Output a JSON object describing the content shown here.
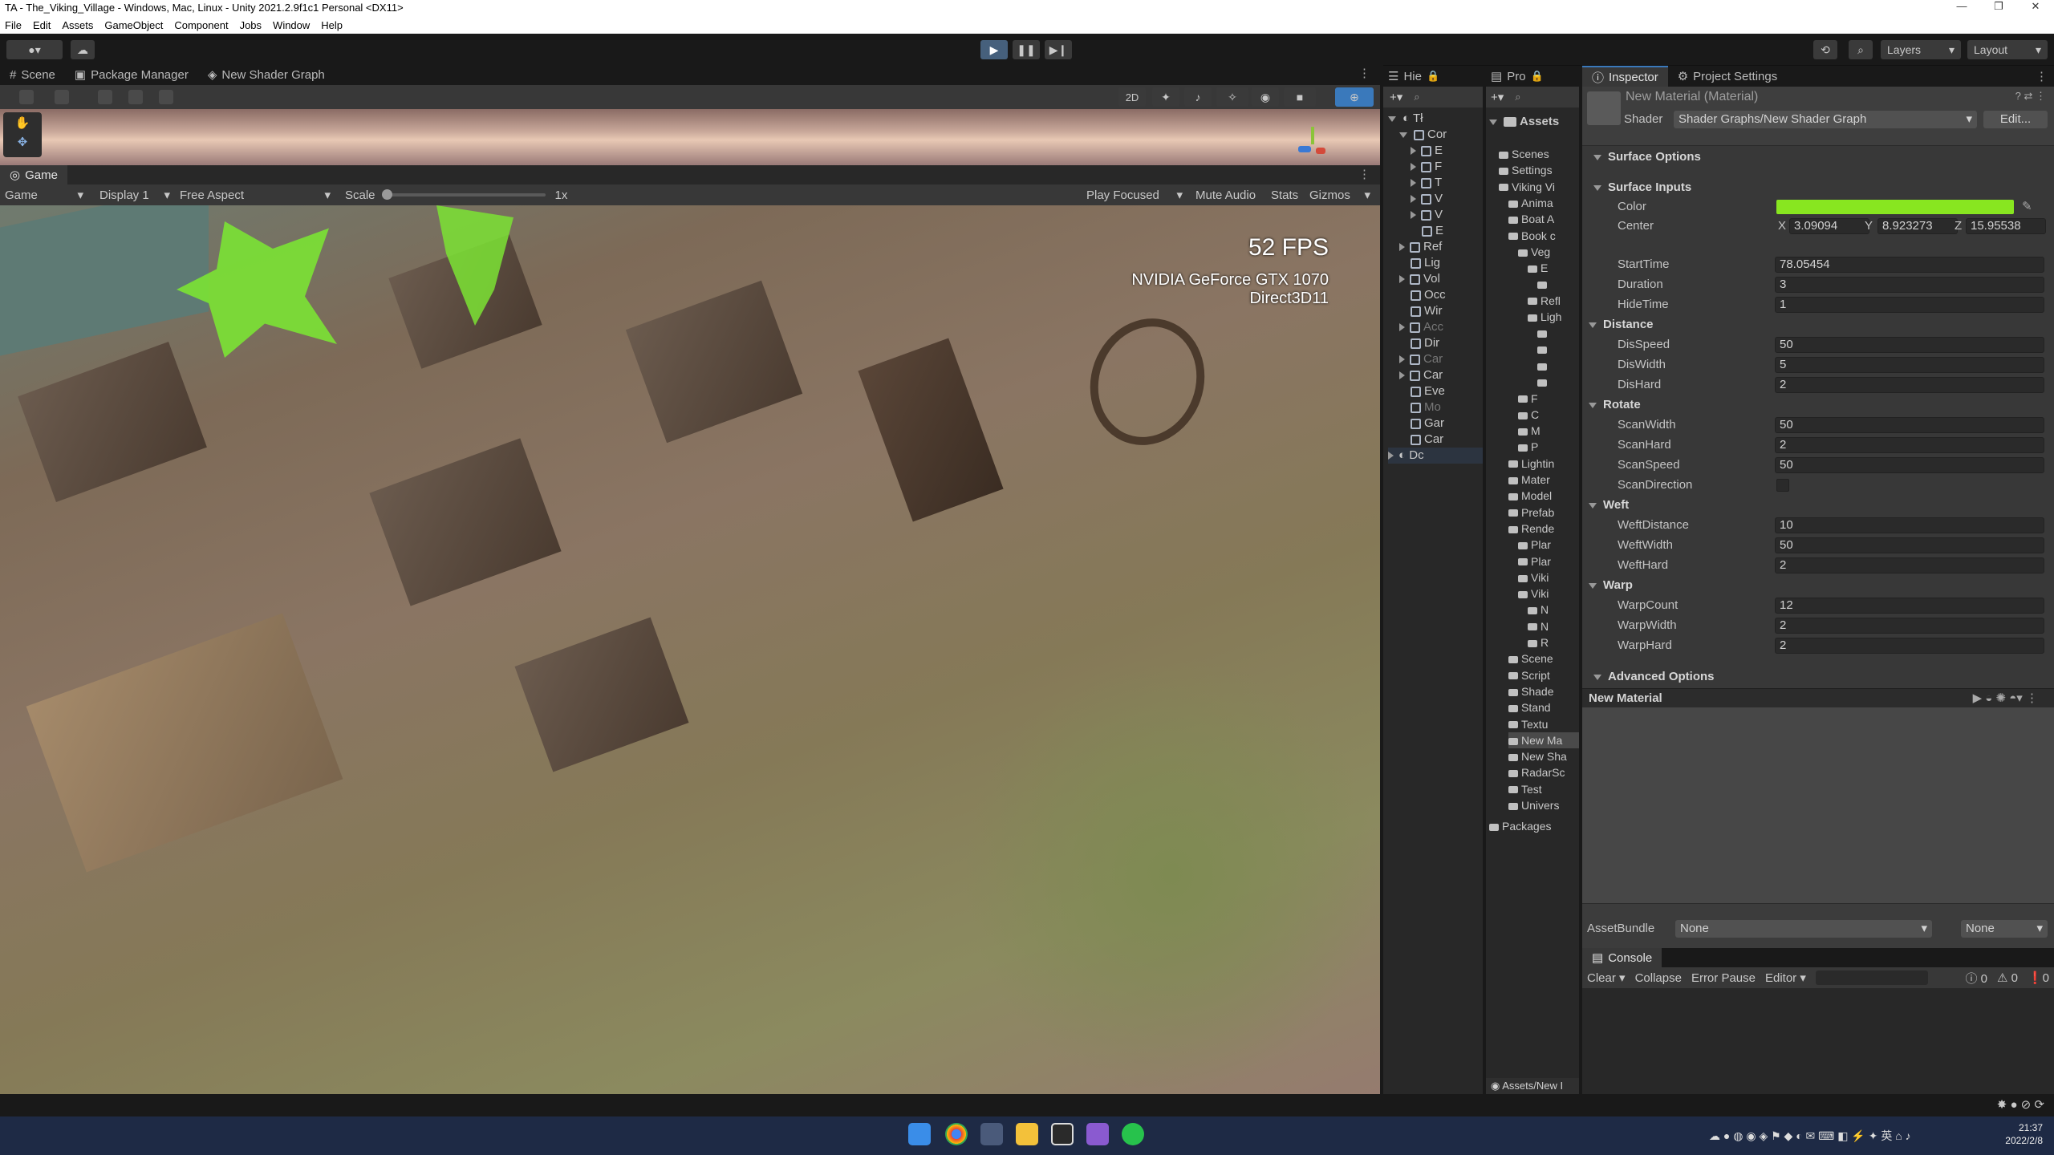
{
  "window": {
    "title": "TA - The_Viking_Village - Windows, Mac, Linux - Unity 2021.2.9f1c1 Personal <DX11>"
  },
  "menu": [
    "File",
    "Edit",
    "Assets",
    "GameObject",
    "Component",
    "Jobs",
    "Window",
    "Help"
  ],
  "toolbar": {
    "layers": "Layers",
    "layout": "Layout"
  },
  "tabs": {
    "scene": "Scene",
    "package_manager": "Package Manager",
    "shader_graph": "New Shader Graph",
    "game": "Game",
    "hierarchy": "Hie",
    "project": "Pro",
    "inspector": "Inspector",
    "project_settings": "Project Settings",
    "console": "Console"
  },
  "scene_toolbar": {
    "mode_2d": "2D"
  },
  "game_toolbar": {
    "view": "Game",
    "display": "Display 1",
    "aspect": "Free Aspect",
    "scale_label": "Scale",
    "scale_value": "1x",
    "play_focused": "Play Focused",
    "mute": "Mute Audio",
    "stats": "Stats",
    "gizmos": "Gizmos"
  },
  "overlay": {
    "fps": "52 FPS",
    "gpu": "NVIDIA GeForce GTX 1070",
    "api": "Direct3D11"
  },
  "hierarchy": {
    "scene": "Tł",
    "items": [
      "Cor",
      "E",
      "F",
      "T",
      "V",
      "V",
      "E",
      "Ref",
      "Lig",
      "Vol",
      "Occ",
      "Wir",
      "Acc",
      "Dir",
      "Car",
      "Car",
      "Eve",
      "Mo",
      "Gar",
      "Car",
      "Dc"
    ]
  },
  "project": {
    "root": "Assets",
    "items": [
      "Scenes",
      "Settings",
      "Viking Vi",
      "Anima",
      "Boat A",
      "Book c",
      "Veg",
      "E",
      "",
      "Refl",
      "Ligh",
      "",
      "",
      "",
      "",
      "F",
      "C",
      "M",
      "P",
      "Lightin",
      "Mater",
      "Model",
      "Prefab",
      "Rende",
      "Plar",
      "Plar",
      "Viki",
      "Viki",
      "N",
      "N",
      "R",
      "Scene",
      "Script",
      "Shade",
      "Stand",
      "Textu",
      "New Ma",
      "New Sha",
      "RadarSc",
      "Test",
      "Univers",
      "Packages"
    ],
    "path": "Assets/New I"
  },
  "inspector": {
    "title": "New Material (Material)",
    "shader_label": "Shader",
    "shader_value": "Shader Graphs/New Shader Graph",
    "edit_button": "Edit...",
    "surface_options": "Surface Options",
    "surface_inputs": "Surface Inputs",
    "color_label": "Color",
    "color_value": "#88e620",
    "center_label": "Center",
    "center": {
      "x_label": "X",
      "x": "3.09094",
      "y_label": "Y",
      "y": "8.923273",
      "z_label": "Z",
      "z": "15.95538"
    },
    "start_time": {
      "label": "StartTime",
      "value": "78.05454"
    },
    "duration": {
      "label": "Duration",
      "value": "3"
    },
    "hide_time": {
      "label": "HideTime",
      "value": "1"
    },
    "distance": {
      "header": "Distance",
      "speed_label": "DisSpeed",
      "speed": "50",
      "width_label": "DisWidth",
      "width": "5",
      "hard_label": "DisHard",
      "hard": "2"
    },
    "rotate": {
      "header": "Rotate",
      "width_label": "ScanWidth",
      "width": "50",
      "hard_label": "ScanHard",
      "hard": "2",
      "speed_label": "ScanSpeed",
      "speed": "50",
      "dir_label": "ScanDirection"
    },
    "weft": {
      "header": "Weft",
      "dist_label": "WeftDistance",
      "dist": "10",
      "width_label": "WeftWidth",
      "width": "50",
      "hard_label": "WeftHard",
      "hard": "2"
    },
    "warp": {
      "header": "Warp",
      "count_label": "WarpCount",
      "count": "12",
      "width_label": "WarpWidth",
      "width": "2",
      "hard_label": "WarpHard",
      "hard": "2"
    },
    "advanced": "Advanced Options",
    "preview_title": "New Material",
    "assetbundle_label": "AssetBundle",
    "assetbundle_value": "None",
    "assetbundle_variant": "None"
  },
  "console": {
    "clear": "Clear",
    "collapse": "Collapse",
    "error_pause": "Error Pause",
    "editor": "Editor",
    "log_count": "0",
    "warn_count": "0",
    "err_count": "0"
  },
  "taskbar": {
    "time": "21:37",
    "date": "2022/2/8"
  }
}
